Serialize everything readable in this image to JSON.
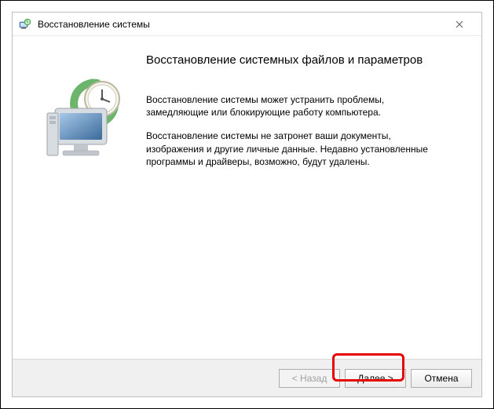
{
  "window": {
    "title": "Восстановление системы"
  },
  "content": {
    "heading": "Восстановление системных файлов и параметров",
    "paragraph1": "Восстановление системы может устранить проблемы, замедляющие или блокирующие работу компьютера.",
    "paragraph2": "Восстановление системы не затронет ваши документы, изображения и другие личные данные. Недавно установленные программы и драйверы, возможно, будут удалены."
  },
  "buttons": {
    "back": "< Назад",
    "next": "Далее >",
    "cancel": "Отмена"
  }
}
